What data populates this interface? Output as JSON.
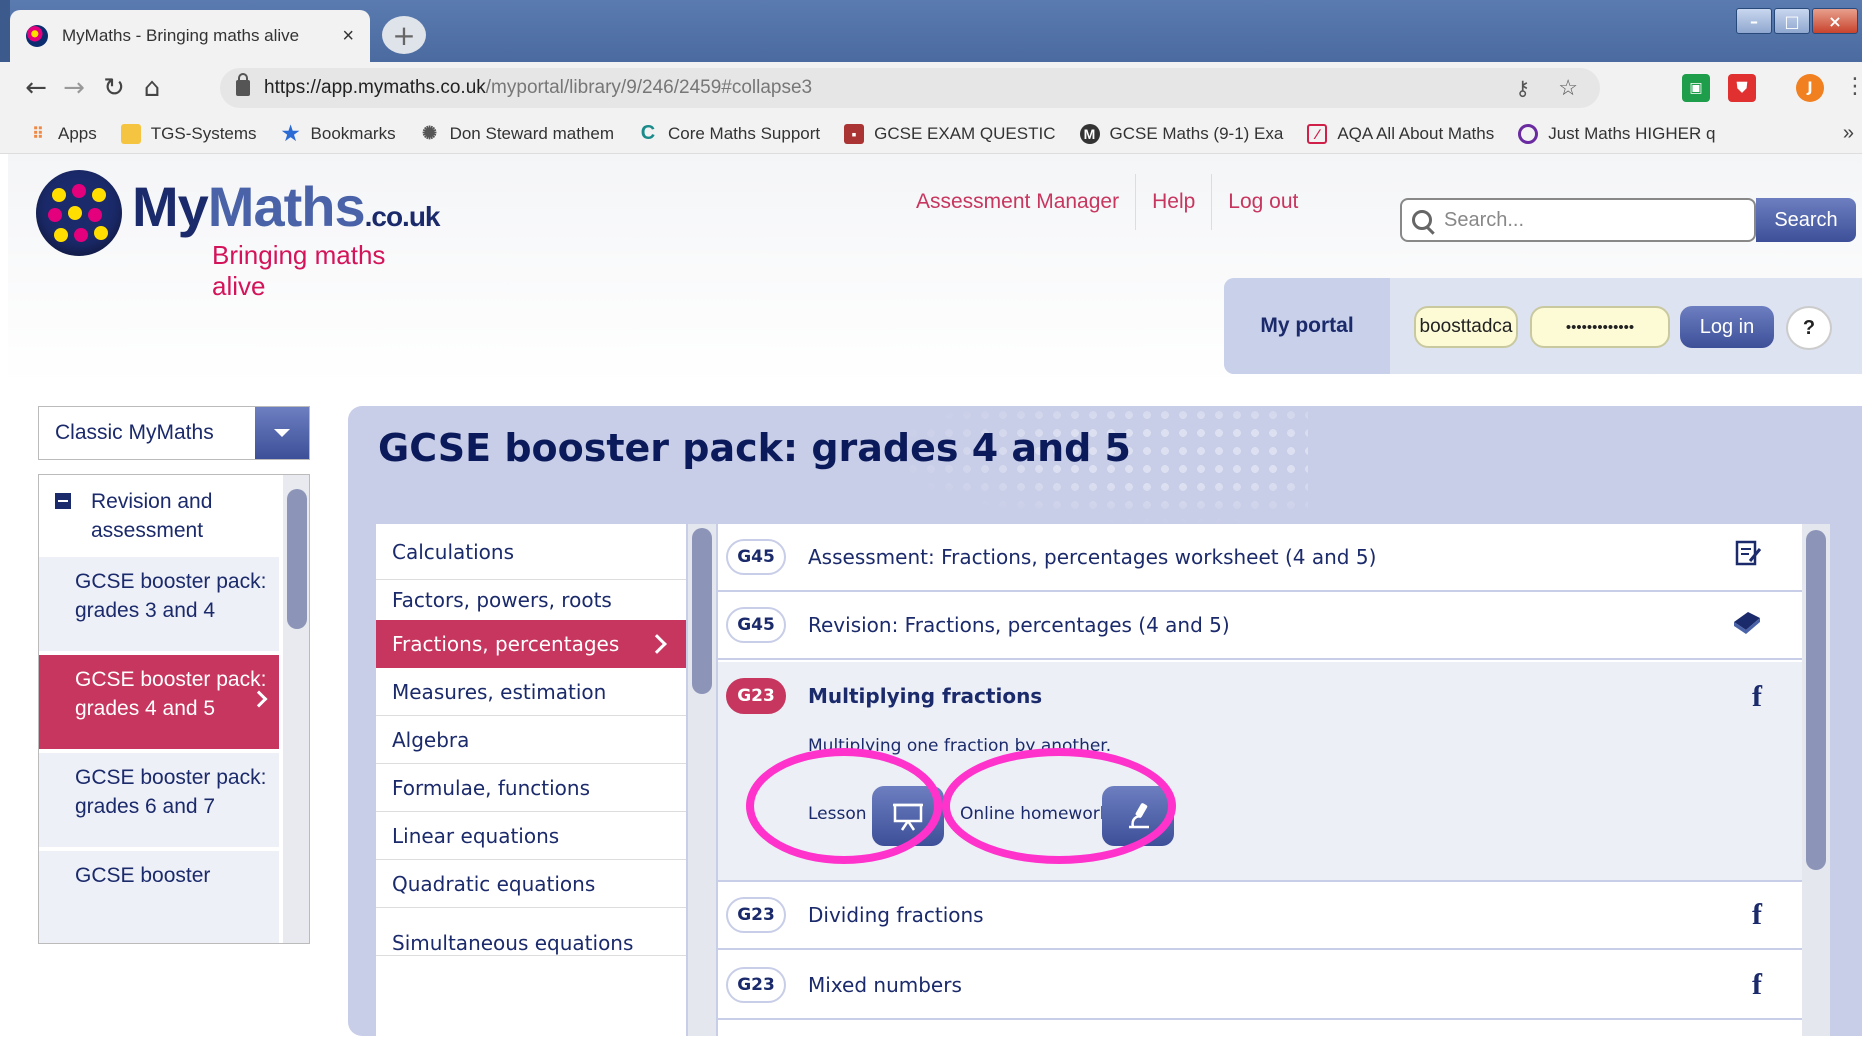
{
  "browser": {
    "tab_title": "MyMaths - Bringing maths alive",
    "tab_close": "×",
    "new_tab": "+",
    "url_host": "https://app.mymaths.co.uk",
    "url_path": "/myportal/library/9/246/2459#collapse3",
    "profile_initial": "J",
    "bookmarks": [
      {
        "label": "Apps",
        "icon": "apps-grid-icon"
      },
      {
        "label": "TGS-Systems",
        "icon": "folder-icon"
      },
      {
        "label": "Bookmarks",
        "icon": "star-icon"
      },
      {
        "label": "Don Steward mathem",
        "icon": "globe-icon"
      },
      {
        "label": "Core Maths Support",
        "icon": "c-logo-icon"
      },
      {
        "label": "GCSE EXAM QUESTIC",
        "icon": "site-icon"
      },
      {
        "label": "GCSE Maths (9-1) Exa",
        "icon": "site-icon"
      },
      {
        "label": "AQA All About Maths",
        "icon": "aqa-icon"
      },
      {
        "label": "Just Maths HIGHER q",
        "icon": "circle-icon"
      }
    ],
    "bookmarks_more": "»"
  },
  "header": {
    "logo_my": "My",
    "logo_maths": "Maths",
    "logo_couk": ".co.uk",
    "tagline": "Bringing maths alive",
    "nav": [
      "Assessment Manager",
      "Help",
      "Log out"
    ],
    "search_placeholder": "Search...",
    "search_button": "Search"
  },
  "portal": {
    "label": "My portal",
    "username": "boosttadca",
    "password": "•••••••••••••",
    "login_button": "Log in",
    "help": "?"
  },
  "sidebar": {
    "selector": "Classic MyMaths",
    "section": "Revision and assessment",
    "items": [
      {
        "label": "GCSE booster pack: grades 3 and 4",
        "active": false
      },
      {
        "label": "GCSE booster pack: grades 4 and 5",
        "active": true
      },
      {
        "label": "GCSE booster pack: grades 6 and 7",
        "active": false
      },
      {
        "label": "GCSE booster",
        "active": false
      }
    ]
  },
  "main": {
    "title": "GCSE booster pack: grades 4 and 5",
    "categories": [
      "Calculations",
      "Factors, powers, roots",
      "Fractions, percentages",
      "Measures, estimation",
      "Algebra",
      "Formulae, functions",
      "Linear equations",
      "Quadratic equations",
      "Simultaneous equations"
    ],
    "active_category": "Fractions, percentages",
    "lessons": [
      {
        "code": "G45",
        "title": "Assessment: Fractions, percentages worksheet (4 and 5)",
        "icon": "worksheet-icon"
      },
      {
        "code": "G45",
        "title": "Revision: Fractions, percentages (4 and 5)",
        "icon": "book-icon"
      },
      {
        "code": "G23",
        "title": "Multiplying fractions",
        "icon": "f",
        "expanded": true,
        "description": "Multiplying one fraction by another.",
        "lesson_label": "Lesson",
        "homework_label": "Online homework"
      },
      {
        "code": "G23",
        "title": "Dividing fractions",
        "icon": "f"
      },
      {
        "code": "G23",
        "title": "Mixed numbers",
        "icon": "f"
      }
    ]
  },
  "colors": {
    "brand_navy": "#1b2a6b",
    "brand_pink": "#c7365f",
    "panel": "#c8cde8",
    "highlight_ring": "#ff33cc"
  }
}
